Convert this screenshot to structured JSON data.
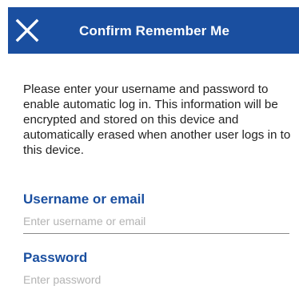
{
  "header": {
    "title": "Confirm Remember Me",
    "close_icon": "close-icon",
    "background_color": "#1a4fa0"
  },
  "intro_text": "Please enter your username and password to enable automatic log in. This information will be encrypted and stored on this device and automatically erased when another user logs in to this device.",
  "fields": {
    "username": {
      "label": "Username or email",
      "placeholder": "Enter username or email",
      "value": ""
    },
    "password": {
      "label": "Password",
      "placeholder": "Enter password",
      "value": ""
    }
  },
  "colors": {
    "accent": "#1a4fa0",
    "text": "#222222",
    "placeholder": "#b3b3b3",
    "underline": "#8a8a8a"
  }
}
